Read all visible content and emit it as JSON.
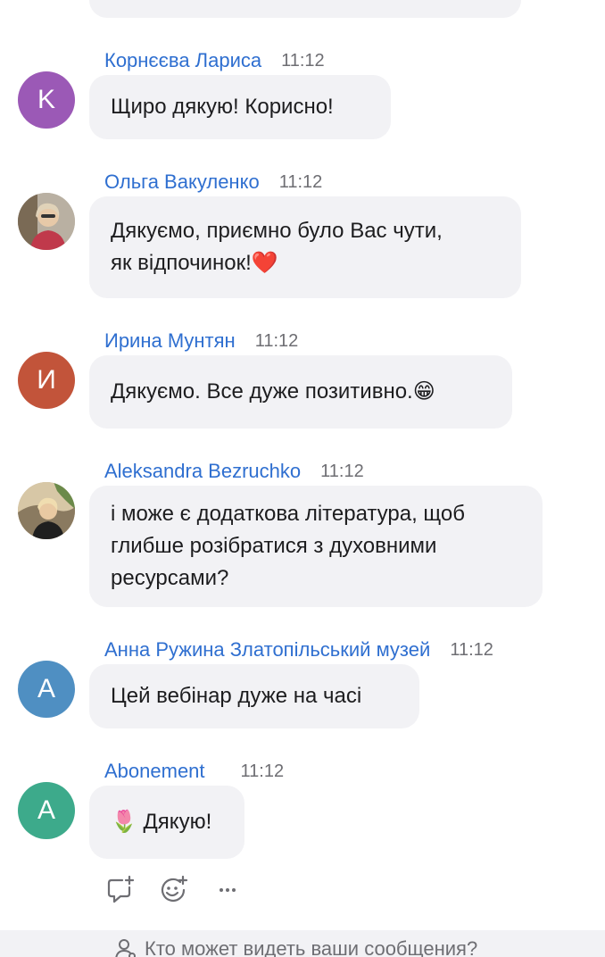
{
  "messages": [
    {
      "sender": "Корнєєва Лариса",
      "time": "11:12",
      "avatar_letter": "K",
      "avatar_color": "#9b59b6",
      "text_lines": [
        "Щиро дякую! Корисно!"
      ]
    },
    {
      "sender": "Ольга Вакуленко",
      "time": "11:12",
      "avatar_letter": "",
      "avatar_color": "#c9c2b6",
      "text_lines": [
        "Дякуємо, приємно було Вас чути,",
        "як відпочинок!❤️"
      ]
    },
    {
      "sender": "Ирина Мунтян",
      "time": "11:12",
      "avatar_letter": "И",
      "avatar_color": "#c2543a",
      "text_lines": [
        "Дякуємо. Все дуже позитивно.😁"
      ]
    },
    {
      "sender": "Aleksandra Bezruchko",
      "time": "11:12",
      "avatar_letter": "",
      "avatar_color": "#c8b79a",
      "text_lines": [
        "і може є додаткова література, щоб",
        "глибше розібратися з духовними",
        "ресурсами?"
      ]
    },
    {
      "sender": "Анна Ружина Златопільський музей",
      "time": "11:12",
      "avatar_letter": "A",
      "avatar_color": "#4f8fc2",
      "text_lines": [
        "Цей вебінар дуже на часі"
      ]
    },
    {
      "sender": "Abonement",
      "time": "11:12",
      "avatar_letter": "A",
      "avatar_color": "#3daa8b",
      "text_lines": [
        "🌷 Дякую!"
      ]
    }
  ],
  "actions": [
    "reply-icon",
    "add-reaction-icon",
    "more-icon"
  ],
  "footer": {
    "text": "Кто может видеть ваши сообщения?",
    "icon": "person-icon"
  }
}
